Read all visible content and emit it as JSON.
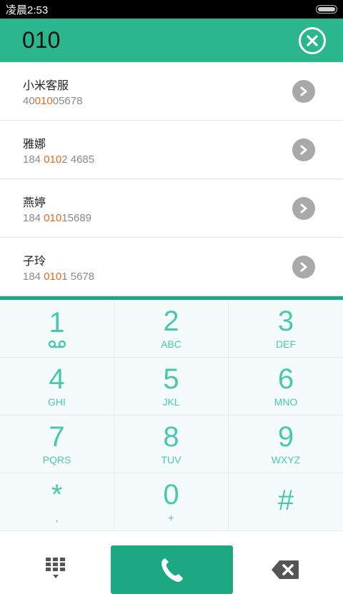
{
  "status_bar": {
    "time": "凌晨2:53"
  },
  "header": {
    "number": "010"
  },
  "contacts": [
    {
      "name": "小米客服",
      "pre": "40",
      "match": "010",
      "post": "05678"
    },
    {
      "name": "雅娜",
      "pre": "184 ",
      "match": "010",
      "post": "2 4685"
    },
    {
      "name": "燕婷",
      "pre": "184 ",
      "match": "010",
      "post": "15689"
    },
    {
      "name": "子玲",
      "pre": "184 ",
      "match": "010",
      "post": "1 5678"
    }
  ],
  "keypad": [
    {
      "digit": "1",
      "letters": ""
    },
    {
      "digit": "2",
      "letters": "ABC"
    },
    {
      "digit": "3",
      "letters": "DEF"
    },
    {
      "digit": "4",
      "letters": "GHI"
    },
    {
      "digit": "5",
      "letters": "JKL"
    },
    {
      "digit": "6",
      "letters": "MNO"
    },
    {
      "digit": "7",
      "letters": "PQRS"
    },
    {
      "digit": "8",
      "letters": "TUV"
    },
    {
      "digit": "9",
      "letters": "WXYZ"
    },
    {
      "digit": "*",
      "letters": ","
    },
    {
      "digit": "0",
      "letters": "+"
    },
    {
      "digit": "#",
      "letters": ""
    }
  ],
  "colors": {
    "accent": "#2bb68e",
    "call": "#1ca882",
    "highlight": "#e2691c",
    "key_text": "#48c9ad"
  }
}
